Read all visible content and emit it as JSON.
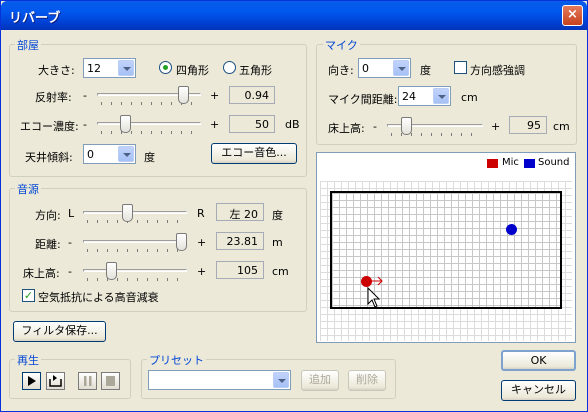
{
  "window": {
    "title": "リバーブ",
    "close": "×"
  },
  "room": {
    "label": "部屋",
    "size_label": "大きさ:",
    "size_value": "12",
    "shape_square": "四角形",
    "shape_pentagon": "五角形",
    "reflect_label": "反射率:",
    "reflect_value": "0.94",
    "echo_label": "エコー濃度:",
    "echo_value": "50",
    "echo_unit": "dB",
    "ceiling_label": "天井傾斜:",
    "ceiling_value": "0",
    "ceiling_unit": "度",
    "echo_color_button": "エコー音色...",
    "minus": "-",
    "plus": "+"
  },
  "source": {
    "label": "音源",
    "dir_label": "方向:",
    "dir_l": "L",
    "dir_r": "R",
    "dir_value": "左 20",
    "dir_unit": "度",
    "dist_label": "距離:",
    "dist_value": "23.81",
    "dist_unit": "m",
    "height_label": "床上高:",
    "height_value": "105",
    "height_unit": "cm",
    "air_label": "空気抵抗による高音減衰"
  },
  "mic": {
    "label": "マイク",
    "dir_label": "向き:",
    "dir_value": "0",
    "dir_unit": "度",
    "emph_label": "方向感強調",
    "dist_label": "マイク間距離:",
    "dist_value": "24",
    "dist_unit": "cm",
    "height_label": "床上高:",
    "height_value": "95",
    "height_unit": "cm"
  },
  "legend": {
    "mic": "Mic",
    "sound": "Sound",
    "mic_color": "#cc0000",
    "sound_color": "#0000cc"
  },
  "filter_button": "フィルタ保存...",
  "playback": {
    "label": "再生"
  },
  "preset": {
    "label": "プリセット",
    "value": "",
    "add": "追加",
    "delete": "削除"
  },
  "ok": "OK",
  "cancel": "キャンセル"
}
